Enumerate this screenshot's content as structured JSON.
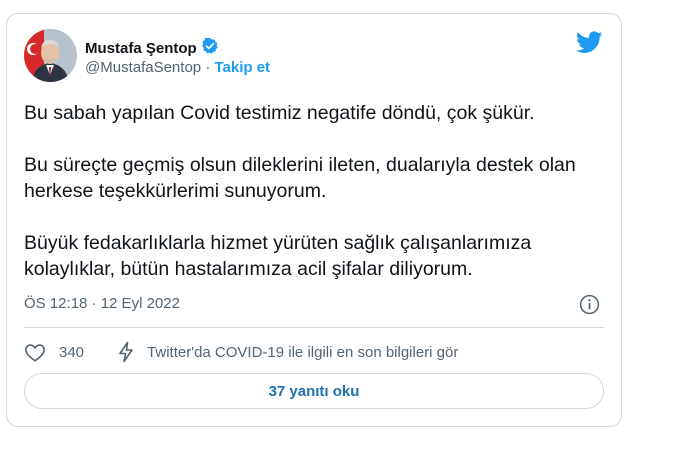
{
  "author": {
    "name": "Mustafa Şentop",
    "handle": "@MustafaSentop",
    "separator": "·",
    "follow_label": "Takip et"
  },
  "icons": {
    "verified": "verified-badge-icon",
    "logo": "twitter-bird-icon",
    "info": "info-icon",
    "like": "heart-icon",
    "covid": "lightning-icon"
  },
  "tweet": {
    "paragraphs": [
      "Bu sabah yapılan Covid testimiz negatife döndü, çok şükür.",
      "Bu süreçte geçmiş olsun dileklerini ileten, dualarıyla destek olan herkese teşekkürlerimi sunuyorum.",
      "Büyük fedakarlıklarla hizmet yürüten sağlık çalışanlarımıza kolaylıklar, bütün hastalarımıza acil şifalar diliyorum."
    ],
    "timestamp": "ÖS 12:18 · 12 Eyl 2022"
  },
  "actions": {
    "like_count": "340",
    "covid_text": "Twitter'da COVID-19 ile ilgili en son bilgileri gör"
  },
  "replies_label": "37 yanıtı oku",
  "colors": {
    "accent": "#1d9bf0",
    "muted": "#536471",
    "border": "#cfd9de"
  }
}
